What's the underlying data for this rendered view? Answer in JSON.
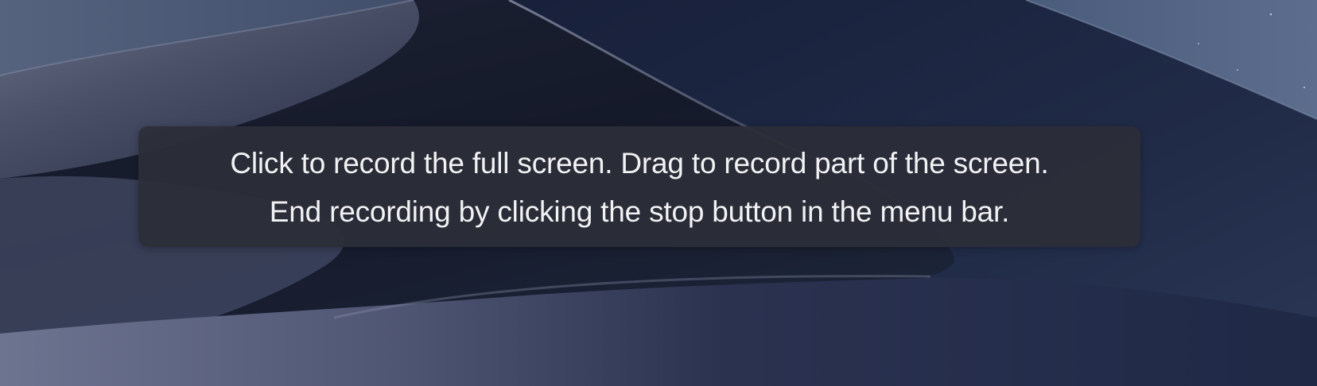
{
  "overlay": {
    "line1": "Click to record the full screen. Drag to record part of the screen.",
    "line2": "End recording by clicking the stop button in the menu bar."
  },
  "colors": {
    "overlay_background": "#2c2e38",
    "overlay_text": "#f2f2f4",
    "sky": "#4a5a78",
    "dune_dark": "#161b2b",
    "dune_light": "#7e869e"
  }
}
